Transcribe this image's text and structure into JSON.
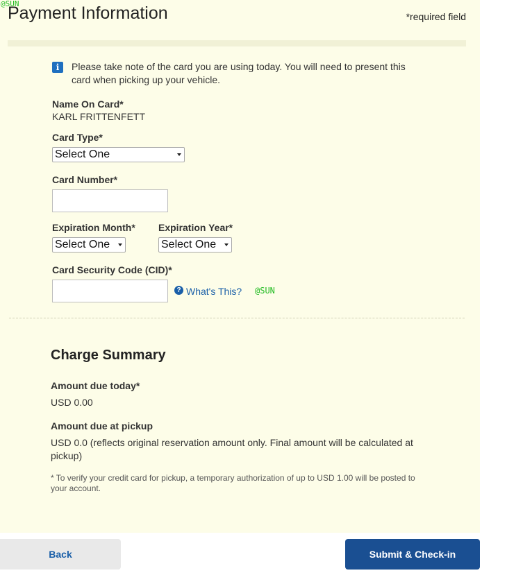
{
  "watermark": "@SUN",
  "header": {
    "title": "Payment Information",
    "required_note": "*required field"
  },
  "notice": {
    "icon": "info-icon",
    "text": "Please take note of the card you are using today. You will need to present this card when picking up your vehicle."
  },
  "form": {
    "name_on_card_label": "Name On Card*",
    "name_on_card_value": "KARL FRITTENFETT",
    "card_type_label": "Card Type*",
    "card_type_value": "Select One",
    "card_number_label": "Card Number*",
    "card_number_value": "",
    "exp_month_label": "Expiration Month*",
    "exp_month_value": "Select One",
    "exp_year_label": "Expiration Year*",
    "exp_year_value": "Select One",
    "cid_label": "Card Security Code (CID)*",
    "cid_value": "",
    "help_icon": "question-circle-icon",
    "help_link": "What's This?"
  },
  "summary": {
    "title": "Charge Summary",
    "due_today_label": "Amount due today*",
    "due_today_value": "USD 0.00",
    "due_pickup_label": "Amount due at pickup",
    "due_pickup_value": "USD 0.0 (reflects original reservation amount only. Final amount will be calculated at pickup)",
    "footnote": "* To verify your credit card for pickup, a temporary authorization of up to USD 1.00 will be posted to your account."
  },
  "actions": {
    "back_label": "Back",
    "submit_label": "Submit & Check-in"
  },
  "colors": {
    "panel_background": "#fdfde8",
    "link_blue": "#1a5fa8",
    "primary_button": "#1a4f92",
    "secondary_button": "#e9e9e9"
  }
}
